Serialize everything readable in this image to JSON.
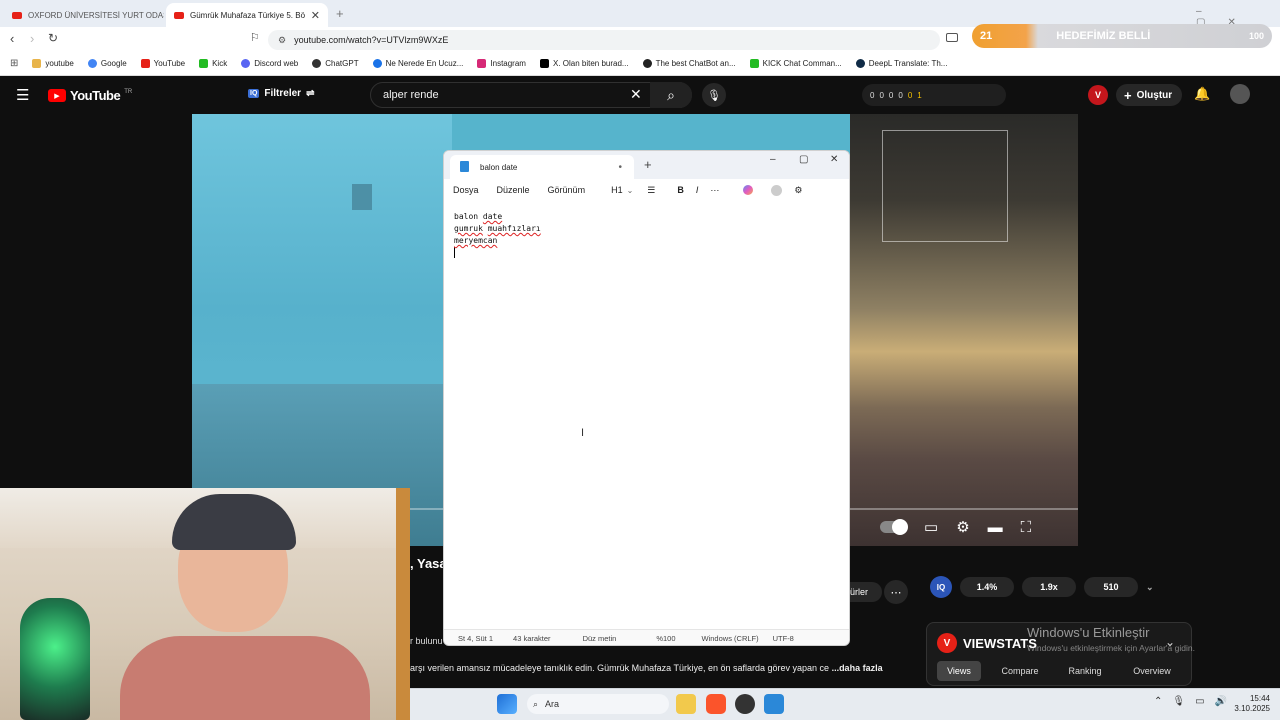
{
  "browser": {
    "tabs": [
      {
        "title": "OXFORD ÜNİVERSİTESİ YURT ODASI"
      },
      {
        "title": "Gümrük Muhafaza Türkiye 5. Bö"
      }
    ],
    "url": "youtube.com/watch?v=UTVlzm9WXzE",
    "bookmarks": [
      "youtube",
      "Google",
      "YouTube",
      "Kick",
      "Discord web",
      "ChatGPT",
      "Ne Nerede En Ucuz...",
      "Instagram",
      "X. Olan biten burad...",
      "The best ChatBot an...",
      "KICK Chat Comman...",
      "DeepL Translate: Th..."
    ],
    "promo": {
      "count": "21",
      "label": "HEDEFİMİZ BELLİ",
      "value": "100"
    }
  },
  "youtube": {
    "logo": "YouTube",
    "region": "TR",
    "filter_label": "Filtreler",
    "search_query": "alper rende",
    "stats": [
      "0",
      "0",
      "0",
      "0",
      "0",
      "1"
    ],
    "create_label": "Oluştur",
    "subscribe_label": "ürler",
    "title_fragment": ", Yasa",
    "desc_fragment": "r bulunu",
    "description_line": "arşı verilen amansız mücadeleye tanıklık edin. Gümrük Muhafaza Türkiye, en ön saflarda görev yapan ce",
    "more_label": "...daha fazla"
  },
  "iq": {
    "label": "IQ",
    "pills": [
      "1.4%",
      "1.9x",
      "510"
    ]
  },
  "viewstats": {
    "title": "VIEWSTATS",
    "tabs": [
      "Views",
      "Compare",
      "Ranking",
      "Overview"
    ],
    "activation_title": "Windows'u Etkinleştir",
    "activation_sub": "Windows'u etkinleştirmek için Ayarlar'a gidin."
  },
  "notepad": {
    "tab_title": "balon date",
    "menu": [
      "Dosya",
      "Düzenle",
      "Görünüm"
    ],
    "heading_label": "H1",
    "lines": [
      "balon date",
      "gumruk",
      "muahfızları",
      "meryemcan"
    ],
    "status": [
      "St 4, Süt 1",
      "43 karakter",
      "Düz metin",
      "%100",
      "Windows (CRLF)",
      "UTF-8"
    ]
  },
  "taskbar": {
    "search_label": "Ara",
    "time": "15:44",
    "date": "3.10.2025"
  },
  "colors": {
    "yt_red": "#ff0000",
    "promo_orange": "#f0a030",
    "viewstats_red": "#e62117"
  }
}
